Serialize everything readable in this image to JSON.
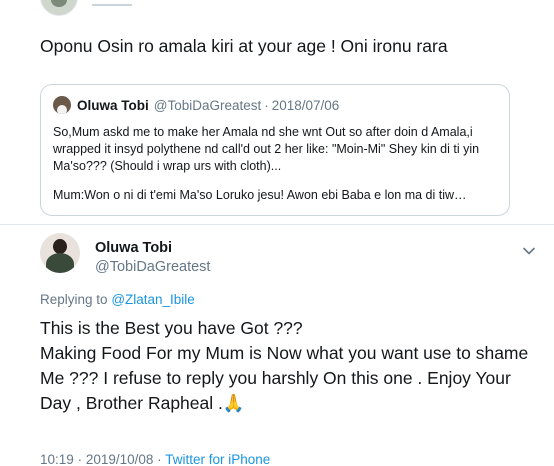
{
  "previous_tweet": {
    "text": "Oponu Osin ro amala kiri at your age ! Oni ironu rara"
  },
  "quoted_tweet": {
    "name": "Oluwa Tobi",
    "handle": "@TobiDaGreatest",
    "separator": "·",
    "date": "2018/07/06",
    "paragraph1": "So,Mum askd me to make her Amala nd she wnt Out so after doin d Amala,i wrapped it insyd polythene nd call'd out 2 her like: \"Moin-Mi\" Shey kin di ti yin Ma'so??? (Should i wrap urs with cloth)...",
    "paragraph2": "Mum:Won o ni di t'emi Ma'so Loruko jesu! Awon ebi Baba e lon ma di tiw…"
  },
  "tweet": {
    "author_name": "Oluwa Tobi",
    "author_handle": "@TobiDaGreatest",
    "replying_prefix": "Replying to",
    "replying_to": "@Zlatan_Ibile",
    "line1": "This is the Best you have Got ???",
    "line2": "Making Food For my Mum is Now what you want use to shame Me ??? I refuse to reply you harshly On this one . Enjoy Your Day , Brother Rapheal .",
    "emoji": "🙏",
    "time": "10:19",
    "separator": "·",
    "date": "2019/10/08",
    "source": "Twitter for iPhone"
  },
  "icons": {
    "chevron": "chevron-down-icon"
  },
  "colors": {
    "link": "#1b95e0",
    "secondary_text": "#657786",
    "border": "#ccd6dd"
  }
}
